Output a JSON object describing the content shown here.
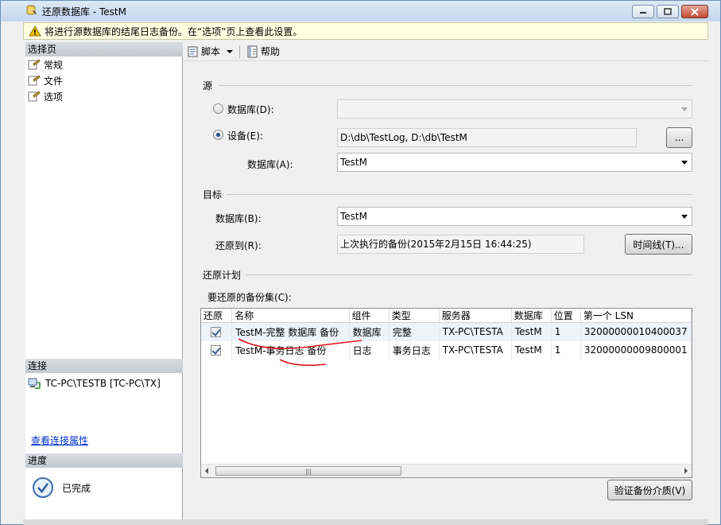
{
  "window": {
    "title": "还原数据库 - TestM",
    "icon": "database-restore-icon"
  },
  "infobar": {
    "message": "将进行源数据库的结尾日志备份。在“选项”页上查看此设置。",
    "icon": "warning-icon"
  },
  "left": {
    "select_page_header": "选择页",
    "pages": [
      {
        "label": "常规",
        "icon": "page-icon"
      },
      {
        "label": "文件",
        "icon": "page-icon"
      },
      {
        "label": "选项",
        "icon": "page-icon"
      }
    ],
    "connection_header": "连接",
    "connection_value": "TC-PC\\TESTB [TC-PC\\TX]",
    "view_connection_link": "查看连接属性",
    "progress_header": "进度",
    "progress_status": "已完成"
  },
  "toolbar": {
    "script_label": "脚本",
    "help_label": "帮助"
  },
  "source": {
    "title": "源",
    "database_radio_label": "数据库(D):",
    "device_radio_label": "设备(E):",
    "device_value": "D:\\db\\TestLog, D:\\db\\TestM",
    "browse_label": "...",
    "database_label": "数据库(A):",
    "database_value": "TestM"
  },
  "target": {
    "title": "目标",
    "database_label": "数据库(B):",
    "database_value": "TestM",
    "restore_to_label": "还原到(R):",
    "restore_to_value": "上次执行的备份(2015年2月15日 16:44:25)",
    "timeline_button": "时间线(T)..."
  },
  "plan": {
    "title": "还原计划",
    "backup_sets_label": "要还原的备份集(C):",
    "columns": [
      "还原",
      "名称",
      "组件",
      "类型",
      "服务器",
      "数据库",
      "位置",
      "第一个 LSN"
    ],
    "rows": [
      {
        "restore": true,
        "name": "TestM-完整 数据库 备份",
        "component": "数据库",
        "type": "完整",
        "server": "TX-PC\\TESTA",
        "database": "TestM",
        "position": "1",
        "first_lsn": "32000000010400037"
      },
      {
        "restore": true,
        "name": "TestM-事务日志  备份",
        "component": "日志",
        "type": "事务日志",
        "server": "TX-PC\\TESTA",
        "database": "TestM",
        "position": "1",
        "first_lsn": "32000000009800001"
      }
    ],
    "verify_button": "验证备份介质(V)"
  },
  "colors": {
    "annotation": "#e0141e",
    "link": "#0033cc",
    "infobar_bg": "#ffffe1"
  }
}
